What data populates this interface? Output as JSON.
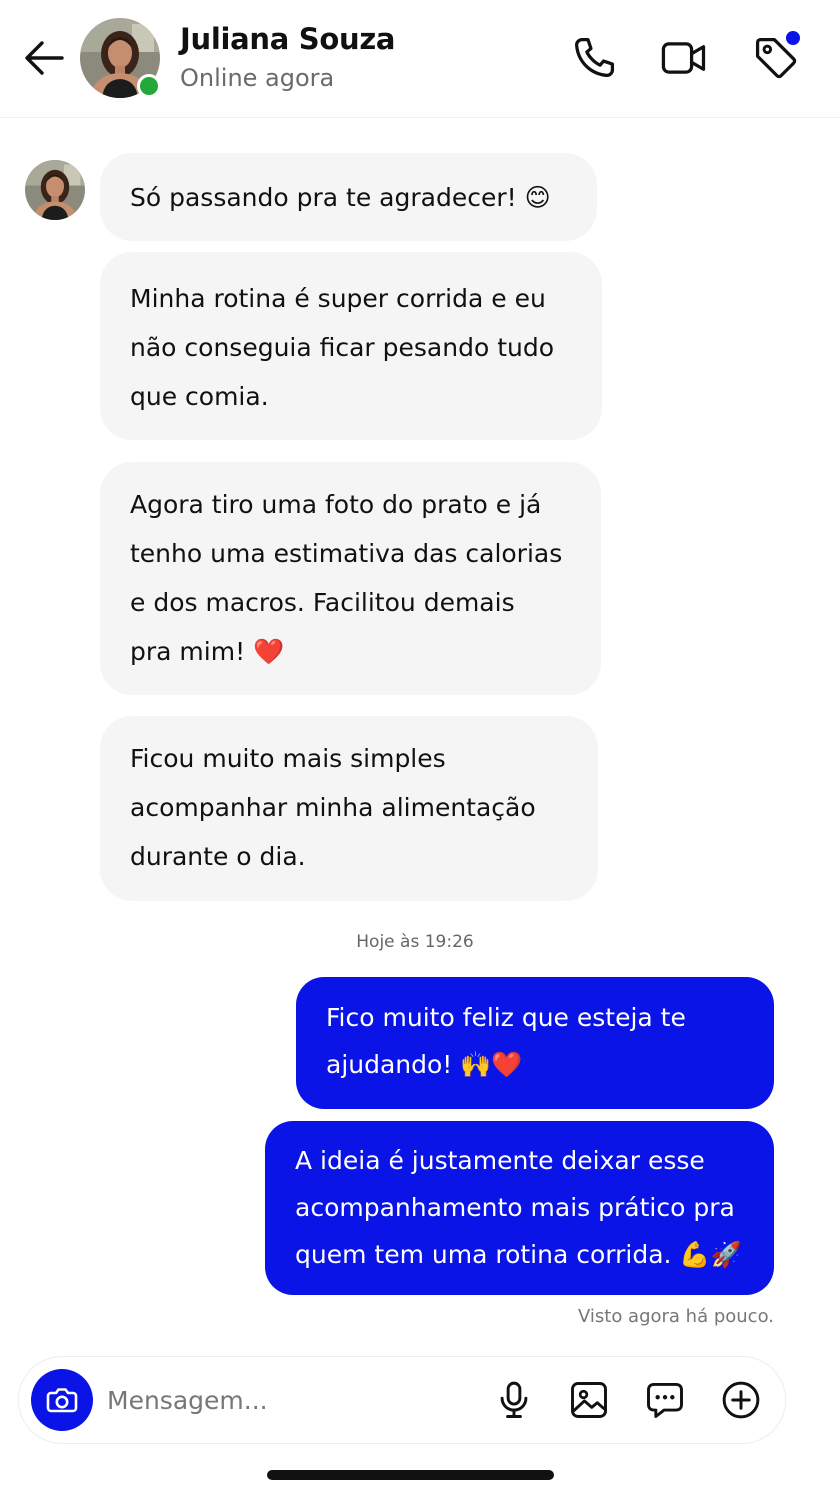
{
  "colors": {
    "accent": "#0a14e6",
    "online": "#22a93a",
    "incoming_bubble": "#f5f5f5",
    "outgoing_text": "#ffffff"
  },
  "header": {
    "contact_name": "Juliana Souza",
    "status": "Online agora",
    "back_icon": "arrow-left-icon",
    "actions": [
      "phone-icon",
      "video-icon",
      "tag-icon"
    ]
  },
  "messages": {
    "incoming": [
      {
        "lines": [
          "Só passando pra te agradecer! 😊"
        ]
      },
      {
        "lines": [
          "Minha rotina é super corrida e eu",
          "não conseguia ficar pesando tudo",
          "que comia."
        ]
      },
      {
        "lines": [
          "Agora tiro uma foto do prato e já",
          "tenho uma estimativa das calorias",
          "e dos macros. Facilitou demais",
          "pra mim! ❤️"
        ]
      },
      {
        "lines": [
          "Ficou muito mais simples",
          "acompanhar minha alimentação",
          "durante o dia."
        ]
      }
    ],
    "timestamp": "Hoje às 19:26",
    "outgoing": [
      {
        "lines": [
          "Fico muito feliz que esteja te",
          "ajudando! 🙌❤️"
        ]
      },
      {
        "lines": [
          "A ideia é justamente deixar esse",
          "acompanhamento mais prático pra",
          "quem tem uma rotina corrida. 💪🚀"
        ]
      }
    ],
    "seen_status": "Visto agora há pouco."
  },
  "composer": {
    "placeholder": "Mensagem...",
    "value": "",
    "icons": [
      "camera-icon",
      "microphone-icon",
      "image-icon",
      "chat-options-icon",
      "plus-circle-icon"
    ]
  }
}
